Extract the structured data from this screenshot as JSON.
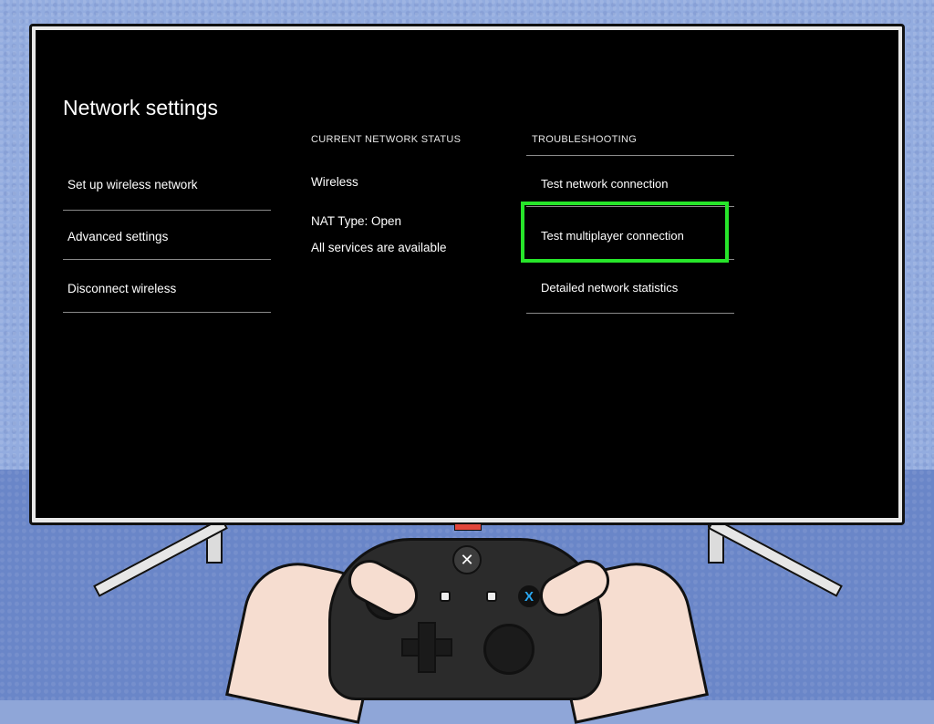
{
  "settings": {
    "title": "Network settings",
    "menu": [
      {
        "label": "Set up wireless network"
      },
      {
        "label": "Advanced settings"
      },
      {
        "label": "Disconnect wireless"
      }
    ],
    "status": {
      "heading": "CURRENT NETWORK STATUS",
      "connection": "Wireless",
      "nat": "NAT Type: Open",
      "services": "All services are available"
    },
    "troubleshooting": {
      "heading": "TROUBLESHOOTING",
      "items": [
        {
          "label": "Test network connection"
        },
        {
          "label": "Test multiplayer connection",
          "selected": true
        },
        {
          "label": "Detailed network statistics"
        }
      ]
    }
  },
  "controller": {
    "guide_icon": "xbox-logo-icon",
    "x_button": "X",
    "x_color": "#2aa8f2"
  },
  "colors": {
    "selection": "#27e52a",
    "screen": "#000000",
    "wall": "#93acdf",
    "table": "#6a86c8"
  }
}
